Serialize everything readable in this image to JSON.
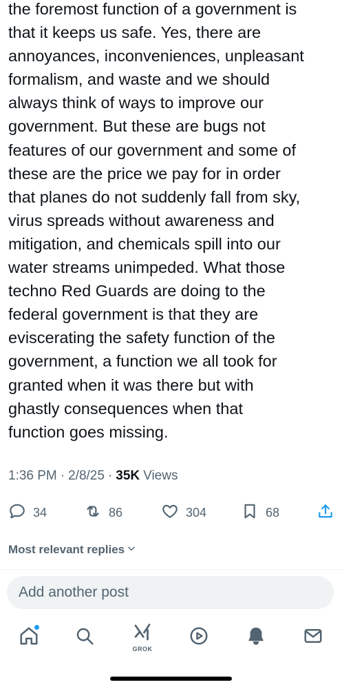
{
  "post": {
    "lines": [
      "the foremost function of a government is",
      "that it keeps us safe. Yes, there are",
      "annoyances, inconveniences, unpleasant",
      "formalism, and waste and we should",
      "always think of ways to improve our",
      "government. But these are bugs not",
      "features of our government and some of",
      "these are the price we pay for in order",
      "that planes do not suddenly fall from sky,",
      "virus spreads without awareness and",
      "mitigation, and chemicals spill into our",
      "water streams unimpeded. What those",
      "techno Red Guards are doing to the",
      "federal government is that they are",
      "eviscerating the safety function of the",
      "government, a function we all took for",
      "granted when it was there but with",
      "ghastly consequences when that",
      "function goes missing."
    ],
    "time": "1:36 PM",
    "date": "2/8/25",
    "views_count": "35K",
    "views_label": "Views",
    "separator": "·"
  },
  "actions": {
    "replies": "34",
    "reposts": "86",
    "likes": "304",
    "bookmarks": "68"
  },
  "replies_sort": {
    "label": "Most relevant replies"
  },
  "compose": {
    "placeholder": "Add another post"
  },
  "tabbar": {
    "grok_label": "GROK"
  },
  "colors": {
    "text": "#0f1419",
    "secondary": "#536471",
    "accent": "#1d9bf0",
    "compose_bg": "#eff3f4"
  },
  "icons": [
    "reply-icon",
    "repost-icon",
    "like-icon",
    "bookmark-icon",
    "share-icon",
    "chevron-down-icon",
    "home-icon",
    "search-icon",
    "grok-icon",
    "video-icon",
    "notifications-icon",
    "messages-icon"
  ]
}
